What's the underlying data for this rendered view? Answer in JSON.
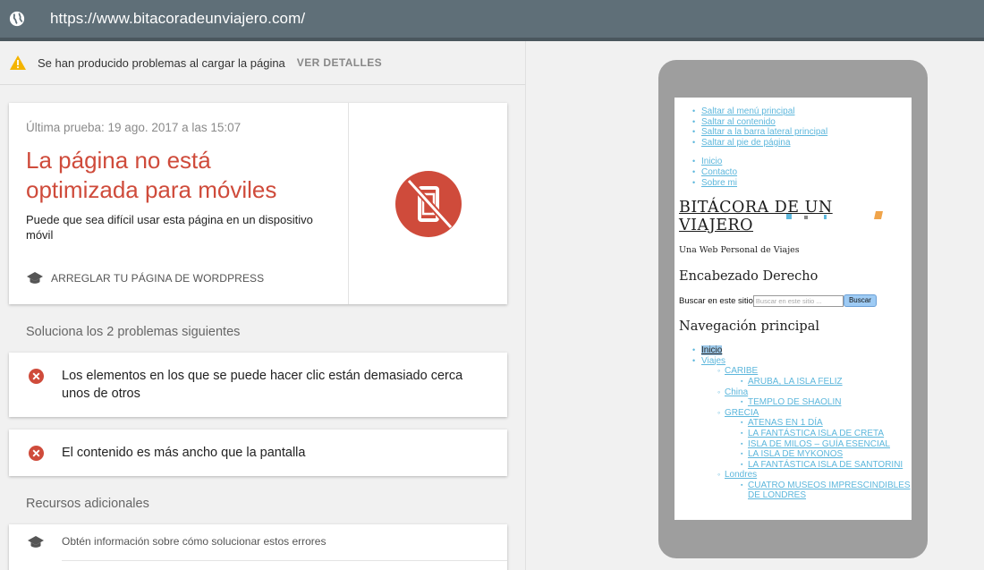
{
  "browser": {
    "url": "https://www.bitacoradeunviajero.com/"
  },
  "warning": {
    "message": "Se han producido problemas al cargar la página",
    "details_label": "VER DETALLES"
  },
  "result": {
    "last_test": "Última prueba: 19 ago. 2017 a las 15:07",
    "verdict_line1": "La página no está",
    "verdict_line2": "optimizada para móviles",
    "subtext": "Puede que sea difícil usar esta página en un dispositivo móvil",
    "fix_label": "ARREGLAR TU PÁGINA DE WORDPRESS",
    "badge_color": "#cf4b3b"
  },
  "problems": {
    "title": "Soluciona los 2 problemas siguientes",
    "items": [
      "Los elementos en los que se puede hacer clic están demasiado cerca unos de otros",
      "El contenido es más ancho que la pantalla"
    ]
  },
  "resources": {
    "title": "Recursos adicionales",
    "items": [
      "Obtén información sobre cómo solucionar estos errores"
    ]
  },
  "preview": {
    "skip_links": [
      "Saltar al menú principal",
      "Saltar al contenido",
      "Saltar a la barra lateral principal",
      "Saltar al pie de página"
    ],
    "top_nav": [
      "Inicio",
      "Contacto",
      "Sobre mi"
    ],
    "site_title": "BITÁCORA DE UN VIAJERO",
    "site_description": "Una Web Personal de Viajes",
    "header_right_title": "Encabezado Derecho",
    "search_label": "Buscar en este sitio",
    "search_placeholder": "Buscar en este sitio ...",
    "search_button": "Buscar",
    "main_nav_title": "Navegación principal",
    "main_nav": {
      "home": "Inicio",
      "trips": "Viajes",
      "caribe": "CARIBE",
      "caribe_items": [
        "ARUBA, LA ISLA FELIZ"
      ],
      "china": "China",
      "china_items": [
        "TEMPLO DE SHAOLIN"
      ],
      "grecia": "GRECIA",
      "grecia_items": [
        "ATENAS EN 1 DÍA",
        "LA FANTÁSTICA ISLA DE CRETA",
        "ISLA DE MILOS – GUÍA ESENCIAL",
        "LA ISLA DE MYKONOS",
        "LA FANTÁSTICA ISLA DE SANTORINI"
      ],
      "londres": "Londres",
      "londres_items": [
        "CUATRO MUSEOS IMPRESCINDIBLES DE LONDRES"
      ]
    }
  }
}
